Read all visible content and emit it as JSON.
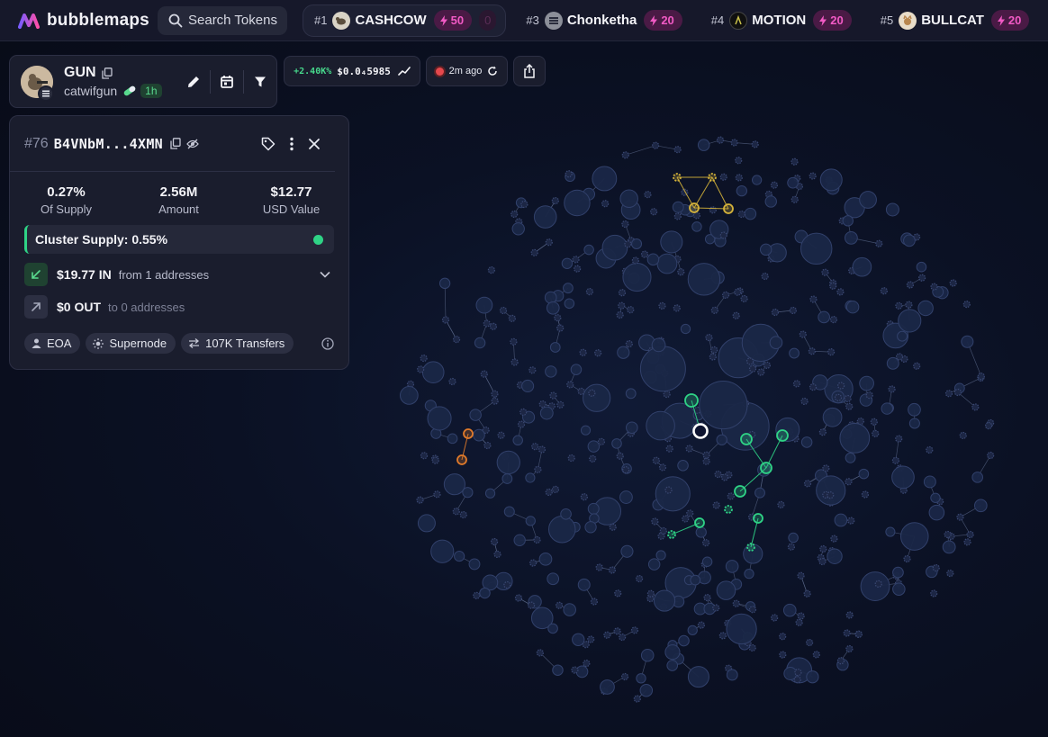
{
  "app": {
    "name": "bubblemaps"
  },
  "search": {
    "label": "Search Tokens"
  },
  "trending": [
    {
      "rank": "#1",
      "name": "CASHCOW",
      "boost": "50",
      "ghost": "0",
      "avatar_color": "#d9d4c6"
    },
    {
      "rank": "#3",
      "name": "Chonketha",
      "boost": "20",
      "avatar_color": "#8c8f99"
    },
    {
      "rank": "#4",
      "name": "MOTION",
      "boost": "20",
      "avatar_color": "#101010"
    },
    {
      "rank": "#5",
      "name": "BULLCAT",
      "boost": "20",
      "avatar_color": "#d8c0a0"
    }
  ],
  "token": {
    "symbol": "GUN",
    "name": "catwifgun",
    "age": "1h"
  },
  "price": {
    "change": "+2.40K%",
    "value": "$0.0₄5985"
  },
  "refresh": {
    "time": "2m ago"
  },
  "wallet": {
    "rank": "#76",
    "address": "B4VNbM...4XMN",
    "stats": [
      {
        "value": "0.27%",
        "label": "Of Supply"
      },
      {
        "value": "2.56M",
        "label": "Amount"
      },
      {
        "value": "$12.77",
        "label": "USD Value"
      }
    ],
    "cluster_supply": "Cluster Supply: 0.55%",
    "flow_in": {
      "amount": "$19.77 IN",
      "desc": "from 1 addresses"
    },
    "flow_out": {
      "amount": "$0 OUT",
      "desc": "to 0 addresses"
    },
    "tags": [
      "EOA",
      "Supernode",
      "107K Transfers"
    ]
  },
  "colors": {
    "accent_green": "#2fd386",
    "boost_pink": "#f25ac5",
    "bubble_fill": "#1a2747",
    "bubble_stroke": "#31406a",
    "cluster_yellow": "#d4b23a",
    "cluster_orange": "#e07a2a"
  }
}
